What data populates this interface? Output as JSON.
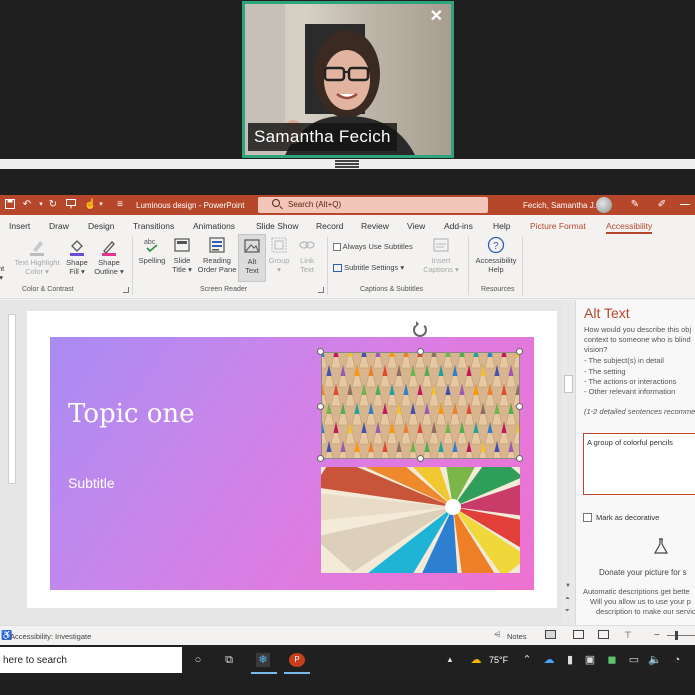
{
  "call": {
    "participant_name": "Samantha Fecich",
    "close_glyph": "✕"
  },
  "window": {
    "file_title": "Luminous design - PowerPoint",
    "search_placeholder": "Search (Alt+Q)",
    "user_name": "Fecich, Samantha J."
  },
  "tabs": {
    "insert": "Insert",
    "draw": "Draw",
    "design": "Design",
    "transitions": "Transitions",
    "animations": "Animations",
    "slide_show": "Slide Show",
    "record": "Record",
    "review": "Review",
    "view": "View",
    "addins": "Add-ins",
    "help": "Help",
    "picture_format": "Picture Format",
    "accessibility": "Accessibility"
  },
  "ribbon": {
    "font_partial": "nt",
    "text_highlight": [
      "Text Highlight",
      "Color"
    ],
    "shape_fill": [
      "Shape",
      "Fill"
    ],
    "shape_outline": [
      "Shape",
      "Outline"
    ],
    "spelling": "Spelling",
    "slide_title": [
      "Slide",
      "Title"
    ],
    "reading_order": [
      "Reading",
      "Order Pane"
    ],
    "alt_text": [
      "Alt",
      "Text"
    ],
    "group": "Group",
    "link_text": [
      "Link",
      "Text"
    ],
    "always_use_subtitles": "Always Use Subtitles",
    "subtitle_settings": "Subtitle Settings",
    "insert_captions": [
      "Insert",
      "Captions"
    ],
    "accessibility_help": [
      "Accessibility",
      "Help"
    ],
    "groups": {
      "color_contrast": "Color & Contrast",
      "screen_reader": "Screen Reader",
      "captions_subtitles": "Captions & Subtitles",
      "resources": "Resources"
    }
  },
  "slide": {
    "title": "Topic one",
    "subtitle": "Subtitle"
  },
  "alt_pane": {
    "title": "Alt Text",
    "question_lines": [
      "How would you describe this obj",
      "context to someone who is blind",
      "vision?"
    ],
    "bullets": [
      "- The subject(s) in detail",
      "- The setting",
      "- The actions or interactions",
      "- Other relevant information"
    ],
    "recommend": "(1-2 detailed sentences recomme",
    "alt_value": "A group of colorful pencils",
    "mark_decorative": "Mark as decorative",
    "donate": "Donate your picture for s",
    "auto_lines": [
      "Automatic descriptions get bette",
      "Will you allow us to use your p",
      "description to make our servic"
    ]
  },
  "status": {
    "accessibility": "Accessibility: Investigate",
    "notes": "Notes"
  },
  "taskbar": {
    "search": "here to search",
    "weather": "75°F"
  },
  "colors": {
    "ppt_accent": "#b7472a",
    "call_border": "#2fa37c"
  }
}
